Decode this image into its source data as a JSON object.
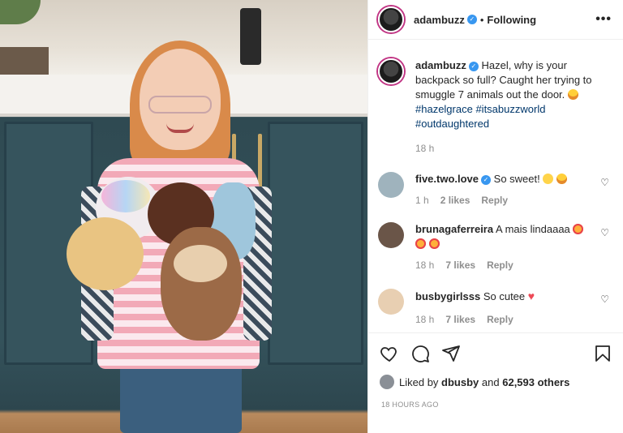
{
  "post": {
    "username": "adambuzz",
    "follow_status": "Following",
    "more_label": "•••"
  },
  "caption": {
    "username": "adambuzz",
    "text": "Hazel, why is your backpack so full? Caught her trying to smuggle 7 animals out the door.",
    "hashtags": [
      "#hazelgrace",
      "#itsabuzzworld",
      "#outdaughtered"
    ],
    "time": "18 h"
  },
  "comments": [
    {
      "username": "five.two.love",
      "text": "So sweet!",
      "time": "1 h",
      "likes": "2 likes",
      "reply": "Reply",
      "avatar_color": "#8ba3b0"
    },
    {
      "username": "brunagaferreira",
      "text": "A mais lindaaaa",
      "time": "18 h",
      "likes": "7 likes",
      "reply": "Reply",
      "avatar_color": "#5a4a40"
    },
    {
      "username": "busbygirlsss",
      "text": "So cutee",
      "time": "18 h",
      "likes": "7 likes",
      "reply": "Reply",
      "avatar_color": "#e6c9a8"
    }
  ],
  "likes": {
    "prefix": "Liked by",
    "user": "dbusby",
    "joiner": "and",
    "count": "62,593 others"
  },
  "timestamp": "18 HOURS AGO",
  "colors": {
    "link": "#00376b",
    "muted": "#8e8e8e",
    "verified": "#3897f0",
    "story_ring": "#c13584"
  }
}
